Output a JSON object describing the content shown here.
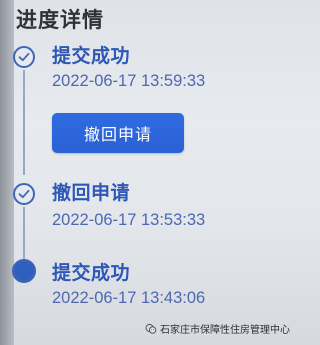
{
  "page": {
    "title": "进度详情"
  },
  "timeline": [
    {
      "status": "提交成功",
      "time": "2022-06-17 13:59:33",
      "icon": "check-icon"
    },
    {
      "status": "撤回申请",
      "time": "2022-06-17 13:53:33",
      "icon": "check-icon"
    },
    {
      "status": "提交成功",
      "time": "2022-06-17 13:43:06",
      "icon": "active-dot-icon"
    }
  ],
  "actions": {
    "withdraw_label": "撤回申请"
  },
  "footer": {
    "source_label": "石家庄市保障性住房管理中心",
    "icon": "wechat-icon"
  },
  "colors": {
    "accent": "#2e58b5",
    "button": "#2a61d4",
    "node_border": "#3f67b8"
  }
}
